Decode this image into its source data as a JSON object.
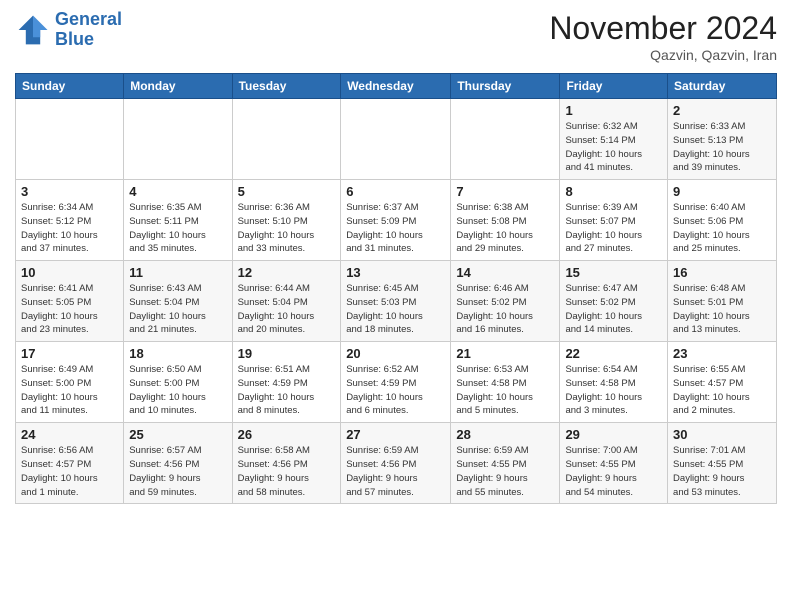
{
  "header": {
    "logo_line1": "General",
    "logo_line2": "Blue",
    "month": "November 2024",
    "location": "Qazvin, Qazvin, Iran"
  },
  "weekdays": [
    "Sunday",
    "Monday",
    "Tuesday",
    "Wednesday",
    "Thursday",
    "Friday",
    "Saturday"
  ],
  "weeks": [
    [
      {
        "day": "",
        "info": ""
      },
      {
        "day": "",
        "info": ""
      },
      {
        "day": "",
        "info": ""
      },
      {
        "day": "",
        "info": ""
      },
      {
        "day": "",
        "info": ""
      },
      {
        "day": "1",
        "info": "Sunrise: 6:32 AM\nSunset: 5:14 PM\nDaylight: 10 hours\nand 41 minutes."
      },
      {
        "day": "2",
        "info": "Sunrise: 6:33 AM\nSunset: 5:13 PM\nDaylight: 10 hours\nand 39 minutes."
      }
    ],
    [
      {
        "day": "3",
        "info": "Sunrise: 6:34 AM\nSunset: 5:12 PM\nDaylight: 10 hours\nand 37 minutes."
      },
      {
        "day": "4",
        "info": "Sunrise: 6:35 AM\nSunset: 5:11 PM\nDaylight: 10 hours\nand 35 minutes."
      },
      {
        "day": "5",
        "info": "Sunrise: 6:36 AM\nSunset: 5:10 PM\nDaylight: 10 hours\nand 33 minutes."
      },
      {
        "day": "6",
        "info": "Sunrise: 6:37 AM\nSunset: 5:09 PM\nDaylight: 10 hours\nand 31 minutes."
      },
      {
        "day": "7",
        "info": "Sunrise: 6:38 AM\nSunset: 5:08 PM\nDaylight: 10 hours\nand 29 minutes."
      },
      {
        "day": "8",
        "info": "Sunrise: 6:39 AM\nSunset: 5:07 PM\nDaylight: 10 hours\nand 27 minutes."
      },
      {
        "day": "9",
        "info": "Sunrise: 6:40 AM\nSunset: 5:06 PM\nDaylight: 10 hours\nand 25 minutes."
      }
    ],
    [
      {
        "day": "10",
        "info": "Sunrise: 6:41 AM\nSunset: 5:05 PM\nDaylight: 10 hours\nand 23 minutes."
      },
      {
        "day": "11",
        "info": "Sunrise: 6:43 AM\nSunset: 5:04 PM\nDaylight: 10 hours\nand 21 minutes."
      },
      {
        "day": "12",
        "info": "Sunrise: 6:44 AM\nSunset: 5:04 PM\nDaylight: 10 hours\nand 20 minutes."
      },
      {
        "day": "13",
        "info": "Sunrise: 6:45 AM\nSunset: 5:03 PM\nDaylight: 10 hours\nand 18 minutes."
      },
      {
        "day": "14",
        "info": "Sunrise: 6:46 AM\nSunset: 5:02 PM\nDaylight: 10 hours\nand 16 minutes."
      },
      {
        "day": "15",
        "info": "Sunrise: 6:47 AM\nSunset: 5:02 PM\nDaylight: 10 hours\nand 14 minutes."
      },
      {
        "day": "16",
        "info": "Sunrise: 6:48 AM\nSunset: 5:01 PM\nDaylight: 10 hours\nand 13 minutes."
      }
    ],
    [
      {
        "day": "17",
        "info": "Sunrise: 6:49 AM\nSunset: 5:00 PM\nDaylight: 10 hours\nand 11 minutes."
      },
      {
        "day": "18",
        "info": "Sunrise: 6:50 AM\nSunset: 5:00 PM\nDaylight: 10 hours\nand 10 minutes."
      },
      {
        "day": "19",
        "info": "Sunrise: 6:51 AM\nSunset: 4:59 PM\nDaylight: 10 hours\nand 8 minutes."
      },
      {
        "day": "20",
        "info": "Sunrise: 6:52 AM\nSunset: 4:59 PM\nDaylight: 10 hours\nand 6 minutes."
      },
      {
        "day": "21",
        "info": "Sunrise: 6:53 AM\nSunset: 4:58 PM\nDaylight: 10 hours\nand 5 minutes."
      },
      {
        "day": "22",
        "info": "Sunrise: 6:54 AM\nSunset: 4:58 PM\nDaylight: 10 hours\nand 3 minutes."
      },
      {
        "day": "23",
        "info": "Sunrise: 6:55 AM\nSunset: 4:57 PM\nDaylight: 10 hours\nand 2 minutes."
      }
    ],
    [
      {
        "day": "24",
        "info": "Sunrise: 6:56 AM\nSunset: 4:57 PM\nDaylight: 10 hours\nand 1 minute."
      },
      {
        "day": "25",
        "info": "Sunrise: 6:57 AM\nSunset: 4:56 PM\nDaylight: 9 hours\nand 59 minutes."
      },
      {
        "day": "26",
        "info": "Sunrise: 6:58 AM\nSunset: 4:56 PM\nDaylight: 9 hours\nand 58 minutes."
      },
      {
        "day": "27",
        "info": "Sunrise: 6:59 AM\nSunset: 4:56 PM\nDaylight: 9 hours\nand 57 minutes."
      },
      {
        "day": "28",
        "info": "Sunrise: 6:59 AM\nSunset: 4:55 PM\nDaylight: 9 hours\nand 55 minutes."
      },
      {
        "day": "29",
        "info": "Sunrise: 7:00 AM\nSunset: 4:55 PM\nDaylight: 9 hours\nand 54 minutes."
      },
      {
        "day": "30",
        "info": "Sunrise: 7:01 AM\nSunset: 4:55 PM\nDaylight: 9 hours\nand 53 minutes."
      }
    ]
  ]
}
